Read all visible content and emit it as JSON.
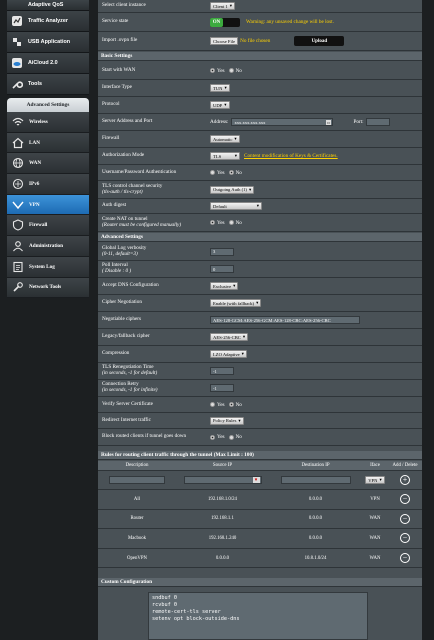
{
  "top_menu": [
    {
      "label": "Adaptive QoS",
      "icon": "qos-icon"
    },
    {
      "label": "Traffic Analyzer",
      "icon": "analyzer-icon"
    },
    {
      "label": "USB Application",
      "icon": "usb-icon"
    },
    {
      "label": "AiCloud 2.0",
      "icon": "cloud-icon"
    },
    {
      "label": "Tools",
      "icon": "tools-icon"
    }
  ],
  "advanced": {
    "header": "Advanced Settings",
    "items": [
      {
        "label": "Wireless",
        "icon": "wifi-icon"
      },
      {
        "label": "LAN",
        "icon": "home-icon"
      },
      {
        "label": "WAN",
        "icon": "globe-icon"
      },
      {
        "label": "IPv6",
        "icon": "ipv6-icon"
      },
      {
        "label": "VPN",
        "icon": "vpn-icon",
        "active": true
      },
      {
        "label": "Firewall",
        "icon": "firewall-icon"
      },
      {
        "label": "Administration",
        "icon": "admin-icon"
      },
      {
        "label": "System Log",
        "icon": "log-icon"
      },
      {
        "label": "Network Tools",
        "icon": "network-tools-icon"
      }
    ]
  },
  "top_rows": {
    "select_client_label": "Select client instance",
    "select_client_value": "Client 1",
    "service_state_label": "Service state",
    "service_state_value": "ON",
    "warning": "Warning: any unsaved change will be lost.",
    "import_label": "Import .ovpn file",
    "choose_file": "Choose File",
    "no_file": "No file chosen",
    "upload": "Upload"
  },
  "basic": {
    "title": "Basic Settings",
    "start_wan_label": "Start with WAN",
    "yes": "Yes",
    "no": "No",
    "interface_label": "Interface Type",
    "interface_value": "TUN",
    "protocol_label": "Protocol",
    "protocol_value": "UDP",
    "server_label": "Server Address and Port",
    "address_label": "Address:",
    "address_value": "xxx.xxx.xxx.xxx",
    "port_label": "Port:",
    "port_value": "",
    "firewall_label": "Firewall",
    "firewall_value": "Automatic",
    "auth_mode_label": "Authorization Mode",
    "auth_mode_value": "TLS",
    "auth_mode_link": "Content modification of Keys & Certificates.",
    "userpass_label": "Username/Password Authentication",
    "tls_label": "TLS control channel security",
    "tls_sub": "(tls-auth / tls-crypt)",
    "tls_value": "Outgoing Auth (1)",
    "auth_digest_label": "Auth digest",
    "auth_digest_value": "Default",
    "nat_label": "Create NAT on tunnel",
    "nat_sub": "(Router must be configured manually)"
  },
  "advanced_settings": {
    "title": "Advanced Settings",
    "verbosity_label": "Global Log verbosity",
    "verbosity_sub": "(0-11, default=3)",
    "verbosity_value": "3",
    "poll_label": "Poll Interval",
    "poll_sub": "( Disable : 0 )",
    "poll_value": "0",
    "dns_label": "Accept DNS Configuration",
    "dns_value": "Exclusive",
    "cipher_neg_label": "Cipher Negotiation",
    "cipher_neg_value": "Enable (with fallback)",
    "neg_ciphers_label": "Negotiable ciphers",
    "neg_ciphers_value": "AES-128-GCM:AES-256-GCM:AES-128-CBC:AES-256-CBC",
    "legacy_label": "Legacy/fallback cipher",
    "legacy_value": "AES-256-CBC",
    "compression_label": "Compression",
    "compression_value": "LZO Adaptive",
    "reneg_label": "TLS Renegotiation Time",
    "reneg_sub": "(in seconds, -1 for default)",
    "reneg_value": "-1",
    "retry_label": "Connection Retry",
    "retry_sub": "(in seconds, -1 for infinite)",
    "retry_value": "-1",
    "verify_label": "Verify Server Certificate",
    "redirect_label": "Redirect Internet traffic",
    "redirect_value": "Policy Rules",
    "block_label": "Block routed clients if tunnel goes down"
  },
  "rules": {
    "title": "Rules for routing client traffic through the tunnel (Max Limit : 100)",
    "headers": [
      "Description",
      "Source IP",
      "Destination IP",
      "Iface",
      "Add / Delete"
    ],
    "new_iface": "VPN",
    "rows": [
      {
        "desc": "All",
        "src": "192.168.1.0/24",
        "dst": "0.0.0.0",
        "iface": "VPN"
      },
      {
        "desc": "Router",
        "src": "192.168.1.1",
        "dst": "0.0.0.0",
        "iface": "WAN"
      },
      {
        "desc": "Macbook",
        "src": "192.168.1.240",
        "dst": "0.0.0.0",
        "iface": "WAN"
      },
      {
        "desc": "OpenVPN",
        "src": "0.0.0.0",
        "dst": "10.8.1.0/24",
        "iface": "WAN"
      }
    ]
  },
  "custom": {
    "title": "Custom Configuration",
    "text": "sndbuf 0\nrcvbuf 0\nremote-cert-tls server\nsetenv opt block-outside-dns"
  }
}
